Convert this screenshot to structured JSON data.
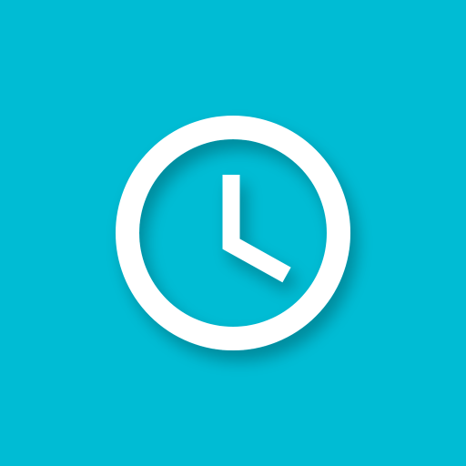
{
  "app_icon": {
    "icon": "clock-icon",
    "background_color": "#00BCD4",
    "foreground_color": "#FFFFFF"
  }
}
